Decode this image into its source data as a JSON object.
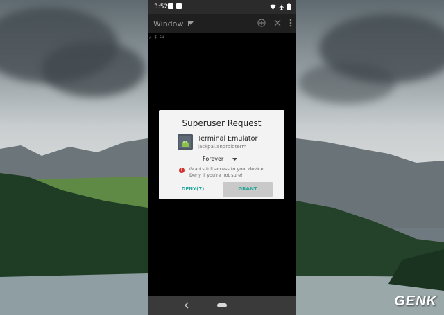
{
  "statusbar": {
    "time": "3:52"
  },
  "appbar": {
    "title": "Window 1"
  },
  "terminal": {
    "prompt": "/ $ su"
  },
  "dialog": {
    "title": "Superuser Request",
    "app_name": "Terminal Emulator",
    "app_package": "jackpal.androidterm",
    "duration": "Forever",
    "warning_line1": "Grants full access to your device.",
    "warning_line2": "Deny if you're not sure!",
    "deny_label": "DENY(7)",
    "grant_label": "GRANT"
  },
  "watermark": "GENK",
  "colors": {
    "accent": "#26a69a",
    "warning": "#d32f2f"
  },
  "icons": [
    "add-tab-icon",
    "close-icon",
    "more-vert-icon",
    "wifi-icon",
    "airplane-icon",
    "battery-icon",
    "back-icon",
    "home-icon",
    "android-icon",
    "warning-icon",
    "dropdown-caret-icon"
  ]
}
